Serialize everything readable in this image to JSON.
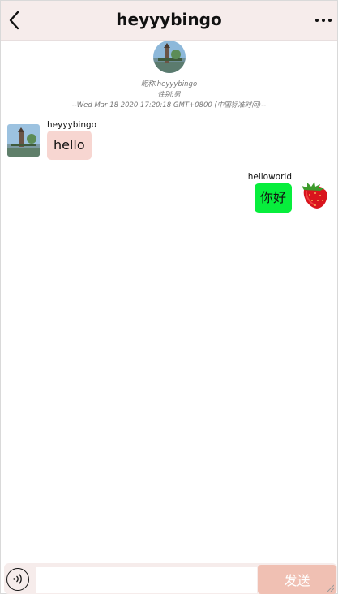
{
  "header": {
    "title": "heyyybingo",
    "back_icon": "chevron-left-icon",
    "more_icon": "ellipsis-icon"
  },
  "profile": {
    "nickname": "昵称:heyyybingo",
    "gender": "性别:男",
    "timestamp": "--Wed Mar 18 2020 17:20:18 GMT+0800 (中国标准时间)--"
  },
  "messages": [
    {
      "direction": "incoming",
      "sender": "heyyybingo",
      "text": "hello"
    },
    {
      "direction": "outgoing",
      "sender": "helloworld",
      "text": "你好"
    }
  ],
  "input": {
    "value": "",
    "placeholder": "",
    "send_label": "发送",
    "voice_icon": "voice-icon"
  },
  "colors": {
    "header_bg": "#f6eceb",
    "incoming_bubble": "#f7d6d1",
    "outgoing_bubble": "#07ee3c",
    "send_button": "#f0c0b3"
  }
}
